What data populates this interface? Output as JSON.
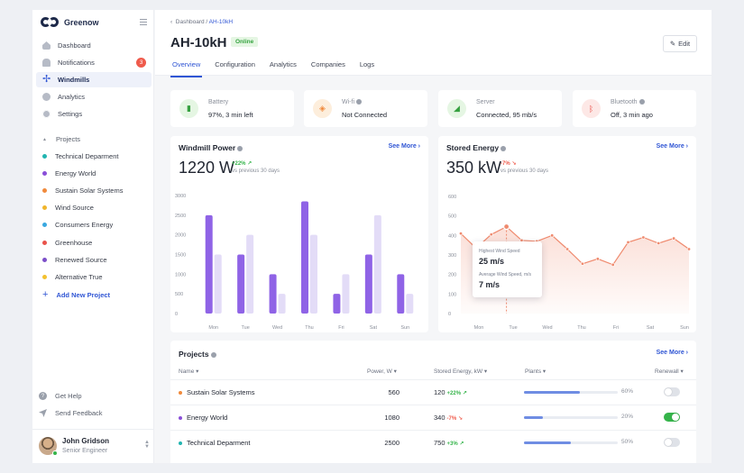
{
  "brand": {
    "name": "Greenow"
  },
  "nav": [
    {
      "label": "Dashboard",
      "icon": "home-icon"
    },
    {
      "label": "Notifications",
      "icon": "bell-icon",
      "badge": "3"
    },
    {
      "label": "Windmills",
      "icon": "windmill-icon"
    },
    {
      "label": "Analytics",
      "icon": "pie-icon"
    },
    {
      "label": "Settings",
      "icon": "gear-icon"
    }
  ],
  "projects_nav": {
    "title": "Projects",
    "items": [
      {
        "label": "Technical Deparment",
        "color": "#22b5b1"
      },
      {
        "label": "Energy World",
        "color": "#8a4fd8"
      },
      {
        "label": "Sustain Solar Systems",
        "color": "#f08a3c"
      },
      {
        "label": "Wind Source",
        "color": "#f0b52c"
      },
      {
        "label": "Consumers Energy",
        "color": "#3aa8e0"
      },
      {
        "label": "Greenhouse",
        "color": "#e9524a"
      },
      {
        "label": "Renewed Source",
        "color": "#7c4fc9"
      },
      {
        "label": "Alternative True",
        "color": "#f3c12f"
      }
    ],
    "add_label": "Add New Project"
  },
  "footer": {
    "help": "Get Help",
    "feedback": "Send Feedback"
  },
  "user": {
    "name": "John Gridson",
    "role": "Senior Engineer"
  },
  "breadcrumb": {
    "parent": "Dashboard",
    "separator": " / ",
    "current": "AH-10kH"
  },
  "device": {
    "title": "AH-10kH",
    "status": "Online",
    "edit_label": "Edit"
  },
  "tabs": [
    "Overview",
    "Configuration",
    "Analytics",
    "Companies",
    "Logs"
  ],
  "status_cards": [
    {
      "label": "Battery",
      "value": "97%, 3 min left",
      "icon": "battery-icon",
      "bg": "#e5f6e3",
      "fg": "#35a03f"
    },
    {
      "label": "Wi-fi",
      "value": "Not Connected",
      "icon": "wifi-icon",
      "bg": "#fdeedc",
      "fg": "#f08a3c",
      "info": true
    },
    {
      "label": "Server",
      "value": "Connected, 95 mb/s",
      "icon": "signal-icon",
      "bg": "#e5f6e3",
      "fg": "#35a03f"
    },
    {
      "label": "Bluetooth",
      "value": "Off, 3 min ago",
      "icon": "bluetooth-icon",
      "bg": "#fde8e6",
      "fg": "#e9524a",
      "info": true
    }
  ],
  "power_card": {
    "title": "Windmill Power",
    "see_more": "See More",
    "value": "1220 W",
    "delta": "+22% ↗",
    "delta_sub": "vs previous 30 days"
  },
  "energy_card": {
    "title": "Stored Energy",
    "see_more": "See More",
    "value": "350 kW",
    "delta": "-7% ↘",
    "delta_sub": "vs previous 30 days"
  },
  "chart_data": [
    {
      "type": "bar",
      "title": "Windmill Power",
      "categories": [
        "Mon",
        "Tue",
        "Wed",
        "Thu",
        "Fri",
        "Sat",
        "Sun"
      ],
      "series": [
        {
          "values": [
            2500,
            1500,
            1000,
            2850,
            500,
            1500,
            1000
          ],
          "color": "#8f63e6"
        },
        {
          "values": [
            1500,
            2000,
            500,
            2000,
            1000,
            2500,
            500
          ],
          "color": "#e3dcf7"
        }
      ],
      "yticks": [
        0,
        500,
        1000,
        1500,
        2000,
        2500,
        3000
      ],
      "ylim": [
        0,
        3000
      ]
    },
    {
      "type": "area",
      "title": "Stored Energy",
      "x": [
        "Mon",
        "",
        "",
        "Tue",
        "",
        "",
        "Wed",
        "",
        "",
        "Thu",
        "",
        "",
        "Fri",
        "",
        "",
        "Sat",
        "",
        "",
        "Sun"
      ],
      "xticks": [
        "Mon",
        "Tue",
        "Wed",
        "Thu",
        "Fri",
        "Sat",
        "Sun"
      ],
      "values": [
        410,
        335,
        405,
        445,
        375,
        370,
        400,
        330,
        255,
        280,
        250,
        365,
        390,
        360,
        385,
        330
      ],
      "yticks": [
        0,
        100,
        200,
        300,
        400,
        500,
        600
      ],
      "ylim": [
        0,
        600
      ],
      "color": "#ef8a6e",
      "tooltip": {
        "label1": "Highest Wind Speed",
        "value1": "25 m/s",
        "label2": "Average Wind Speed, m/s",
        "value2": "7 m/s"
      }
    }
  ],
  "projects_table": {
    "title": "Projects",
    "see_more": "See More",
    "columns": [
      "Name ▾",
      "Power, W ▾",
      "Stored Energy, kW ▾",
      "Plants ▾",
      "Renewall ▾"
    ],
    "rows": [
      {
        "name": "Sustain Solar Systems",
        "color": "#f08a3c",
        "power": "560",
        "energy": "120",
        "delta": "+22% ↗",
        "trend": "up",
        "plants": 60,
        "plants_label": "60%",
        "renewal": false
      },
      {
        "name": "Energy World",
        "color": "#8a4fd8",
        "power": "1080",
        "energy": "340",
        "delta": "-7% ↘",
        "trend": "down",
        "plants": 20,
        "plants_label": "20%",
        "renewal": true
      },
      {
        "name": "Technical Deparment",
        "color": "#22b5b1",
        "power": "2500",
        "energy": "750",
        "delta": "+3% ↗",
        "trend": "up",
        "plants": 50,
        "plants_label": "50%",
        "renewal": false
      }
    ]
  }
}
